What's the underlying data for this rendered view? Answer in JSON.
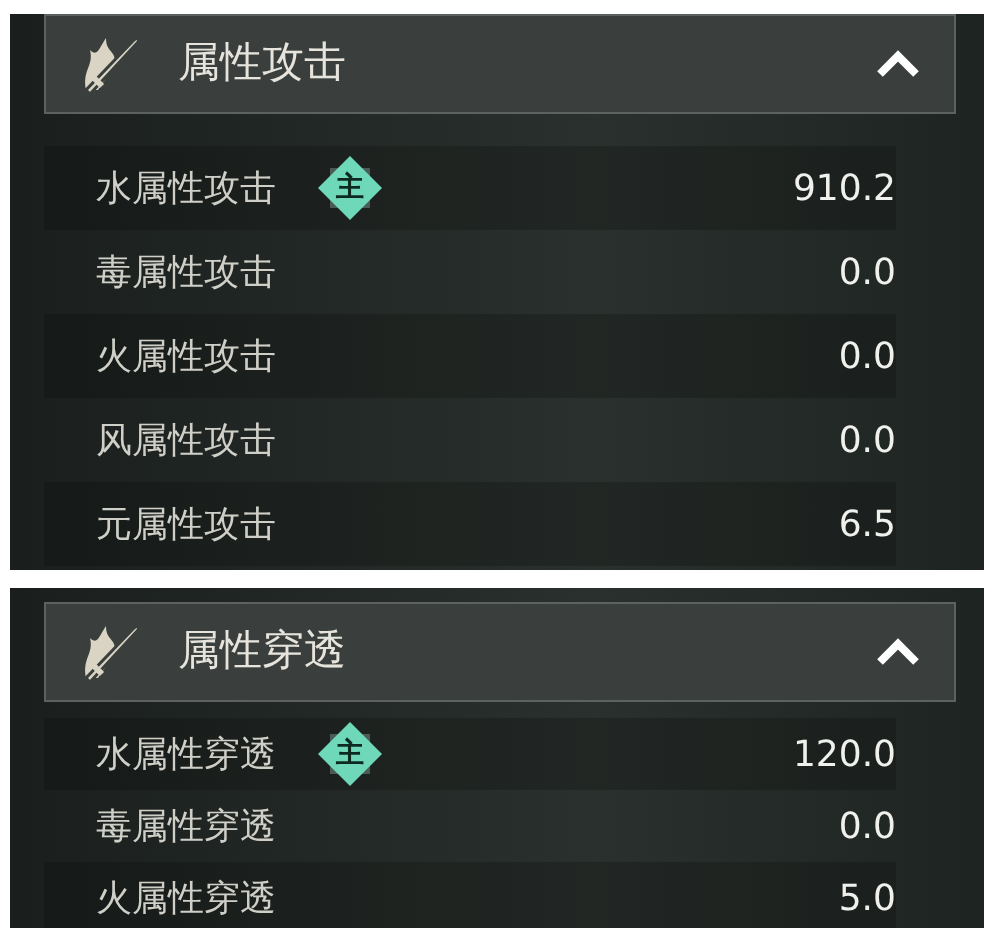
{
  "panels": [
    {
      "title": "属性攻击",
      "expanded": true,
      "rows": [
        {
          "label": "水属性攻击",
          "badge": "主",
          "value": "910.2"
        },
        {
          "label": "毒属性攻击",
          "value": "0.0"
        },
        {
          "label": "火属性攻击",
          "value": "0.0"
        },
        {
          "label": "风属性攻击",
          "value": "0.0"
        },
        {
          "label": "元属性攻击",
          "value": "6.5"
        }
      ]
    },
    {
      "title": "属性穿透",
      "expanded": true,
      "rows": [
        {
          "label": "水属性穿透",
          "badge": "主",
          "value": "120.0"
        },
        {
          "label": "毒属性穿透",
          "value": "0.0"
        },
        {
          "label": "火属性穿透",
          "value": "5.0"
        }
      ]
    }
  ]
}
